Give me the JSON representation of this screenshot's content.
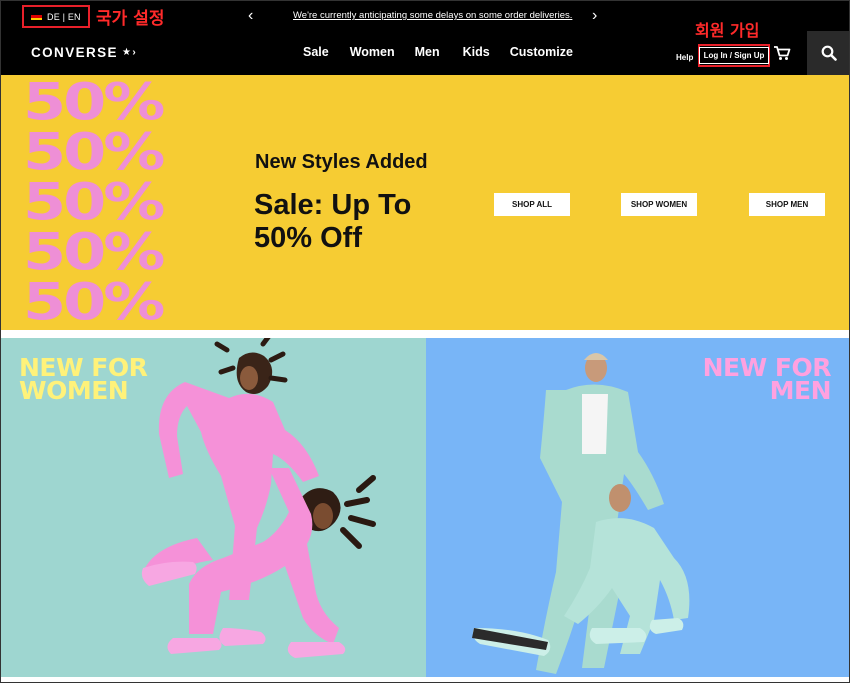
{
  "topbar": {
    "locale_label": "DE | EN",
    "locale_annotation": "국가 설정",
    "announcement": "We're currently anticipating some delays on some order deliveries.",
    "prev_icon": "chevron-left-icon",
    "next_icon": "chevron-right-icon"
  },
  "nav": {
    "logo": "CONVERSE",
    "links": [
      "Sale",
      "Women",
      "Men",
      "Kids",
      "Customize"
    ],
    "help": "Help",
    "login": "Log In / Sign Up",
    "login_annotation": "회원 가입",
    "cart_icon": "cart-icon",
    "search_icon": "search-icon"
  },
  "hero": {
    "pct_text": "50%",
    "subtitle": "New Styles Added",
    "title_line1": "Sale: Up To",
    "title_line2": "50% Off",
    "buttons": [
      "SHOP ALL",
      "SHOP WOMEN",
      "SHOP MEN"
    ]
  },
  "panels": {
    "women_line1": "NEW FOR",
    "women_line2": "WOMEN",
    "men_line1": "NEW FOR",
    "men_line2": "MEN"
  },
  "colors": {
    "hero_bg": "#f6cc33",
    "hero_pct": "#ee8fd6",
    "women_bg": "#9ed6d0",
    "men_bg": "#78b5f7",
    "women_title": "#fff27a",
    "men_title": "#ffa1e0",
    "annotation": "#e8202a"
  }
}
